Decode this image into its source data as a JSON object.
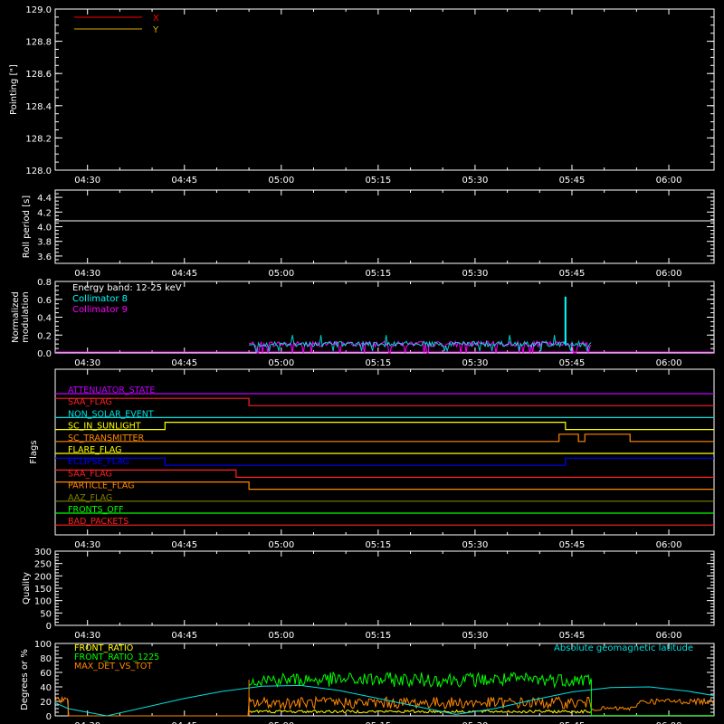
{
  "time_ticks": [
    "04:30",
    "04:45",
    "05:00",
    "05:15",
    "05:30",
    "05:45",
    "06:00"
  ],
  "chart_data": [
    {
      "type": "line",
      "ylabel": "Pointing [\"]",
      "ylim": [
        128.0,
        129.0
      ],
      "yticks": [
        "128.0",
        "128.2",
        "128.4",
        "128.6",
        "128.8",
        "129.0"
      ],
      "legend": [
        {
          "name": "X",
          "color": "#ff0000"
        },
        {
          "name": "Y",
          "color": "#d4b000"
        }
      ],
      "series": []
    },
    {
      "type": "line",
      "ylabel": "Roll period [s]",
      "ylim": [
        3.5,
        4.5
      ],
      "yticks": [
        "3.6",
        "3.8",
        "4.0",
        "4.2",
        "4.4"
      ],
      "series": [
        {
          "color": "#ffffff",
          "x": [
            "04:25",
            "06:07"
          ],
          "values": [
            4.08,
            4.08
          ]
        }
      ]
    },
    {
      "type": "line",
      "ylabel_lines": [
        "Normalized",
        "modulation"
      ],
      "ylim": [
        0.0,
        0.8
      ],
      "yticks": [
        "0.0",
        "0.2",
        "0.4",
        "0.6",
        "0.8"
      ],
      "annotation": "Energy band: 12-25 keV",
      "legend": [
        {
          "name": "Collimator 8",
          "color": "#00ffff"
        },
        {
          "name": "Collimator 9",
          "color": "#ff00ff"
        }
      ],
      "data_window": [
        "04:55",
        "05:48"
      ],
      "baseline": 0.1,
      "spike": {
        "time": "05:44",
        "value": 0.63
      }
    },
    {
      "type": "step",
      "ylabel": "Flags",
      "flags": [
        {
          "name": "ATTENUATOR_STATE",
          "color": "#c000ff",
          "steps": [
            [
              "04:25",
              0
            ],
            [
              "06:07",
              0
            ]
          ]
        },
        {
          "name": "SAA_FLAG",
          "color": "#ff2020",
          "steps": [
            [
              "04:25",
              1
            ],
            [
              "04:55",
              0
            ],
            [
              "06:07",
              0
            ]
          ]
        },
        {
          "name": "NON_SOLAR_EVENT",
          "color": "#00e0e0",
          "steps": [
            [
              "04:25",
              0
            ],
            [
              "06:07",
              0
            ]
          ]
        },
        {
          "name": "SC_IN_SUNLIGHT",
          "color": "#ffff00",
          "steps": [
            [
              "04:25",
              0
            ],
            [
              "04:42",
              1
            ],
            [
              "05:44",
              0
            ],
            [
              "06:07",
              0
            ]
          ]
        },
        {
          "name": "SC_TRANSMITTER",
          "color": "#ff8800",
          "steps": [
            [
              "04:25",
              0
            ],
            [
              "05:43",
              1
            ],
            [
              "05:46",
              0
            ],
            [
              "05:47",
              1
            ],
            [
              "05:54",
              0
            ],
            [
              "06:07",
              0
            ]
          ]
        },
        {
          "name": "FLARE_FLAG",
          "color": "#ffff00",
          "steps": [
            [
              "04:25",
              0
            ],
            [
              "06:07",
              0
            ]
          ]
        },
        {
          "name": "ECLIPSE_FLAG",
          "color": "#0000ff",
          "steps": [
            [
              "04:25",
              1
            ],
            [
              "04:42",
              0
            ],
            [
              "05:44",
              1
            ],
            [
              "06:07",
              1
            ]
          ]
        },
        {
          "name": "SAA_FLAG",
          "color": "#ff2020",
          "steps": [
            [
              "04:25",
              1
            ],
            [
              "04:53",
              0
            ],
            [
              "06:07",
              0
            ]
          ]
        },
        {
          "name": "PARTICLE_FLAG",
          "color": "#ff8800",
          "steps": [
            [
              "04:25",
              1
            ],
            [
              "04:55",
              0
            ],
            [
              "06:07",
              0
            ]
          ]
        },
        {
          "name": "AAZ_FLAG",
          "color": "#808000",
          "steps": [
            [
              "04:25",
              0
            ],
            [
              "06:07",
              0
            ]
          ]
        },
        {
          "name": "FRONTS_OFF",
          "color": "#00ff00",
          "steps": [
            [
              "04:25",
              0
            ],
            [
              "06:07",
              0
            ]
          ]
        },
        {
          "name": "BAD_PACKETS",
          "color": "#ff2020",
          "steps": [
            [
              "04:25",
              0
            ],
            [
              "06:07",
              0
            ]
          ]
        }
      ]
    },
    {
      "type": "line",
      "ylabel": "Quality",
      "ylim": [
        0,
        300
      ],
      "yticks": [
        "0",
        "50",
        "100",
        "150",
        "200",
        "250",
        "300"
      ],
      "series": []
    },
    {
      "type": "line",
      "ylabel": "Degrees or %",
      "ylim": [
        0,
        100
      ],
      "yticks": [
        "0",
        "20",
        "40",
        "60",
        "80",
        "100"
      ],
      "legend": [
        {
          "name": "FRONT_RATIO",
          "color": "#ffff00"
        },
        {
          "name": "FRONT_RATIO_1225",
          "color": "#00ff00"
        },
        {
          "name": "MAX_DET_VS_TOT",
          "color": "#ff8800"
        }
      ],
      "annotation": {
        "text": "Absolute geomagnetic latitude",
        "color": "#00e0e0"
      },
      "geomag_latitude": {
        "color": "#00e0e0",
        "x": [
          "04:25",
          "04:27",
          "04:33",
          "04:39",
          "04:45",
          "04:51",
          "04:57",
          "05:03",
          "05:09",
          "05:15",
          "05:21",
          "05:27",
          "05:33",
          "05:39",
          "05:45",
          "05:51",
          "05:57",
          "06:03",
          "06:07"
        ],
        "values": [
          18,
          10,
          0,
          12,
          24,
          34,
          41,
          42,
          35,
          24,
          13,
          2,
          10,
          22,
          33,
          39,
          40,
          34,
          28
        ]
      },
      "data_window": [
        "04:55",
        "05:48"
      ],
      "front_ratio_1225_level": 50,
      "max_det_vs_tot_level": 18,
      "front_ratio_level": 6
    }
  ]
}
